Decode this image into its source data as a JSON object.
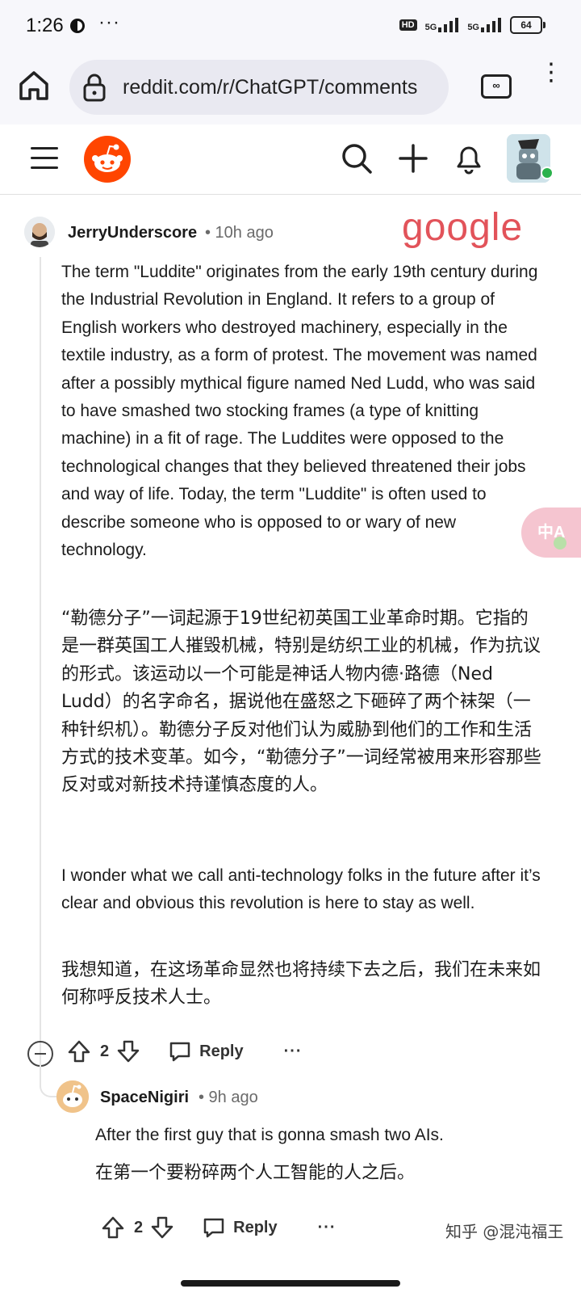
{
  "status_bar": {
    "time": "1:26",
    "more": "···",
    "hd": "HD",
    "signal1": "5G",
    "signal2": "5G",
    "battery": "64"
  },
  "browser": {
    "url": "reddit.com/r/ChatGPT/comments",
    "tabs_icon": "∞"
  },
  "comment": {
    "author": "JerryUnderscore",
    "time": "• 10h ago",
    "tag": "google",
    "body_en_1": "The term \"Luddite\" originates from the early 19th century during the Industrial Revolution in England. It refers to a group of English workers who destroyed machinery, especially in the textile industry, as a form of protest. The movement was named after a possibly mythical figure named Ned Ludd, who was said to have smashed two stocking frames (a type of knitting machine) in a fit of rage. The Luddites were opposed to the technological changes that they believed threatened their jobs and way of life. Today, the term \"Luddite\" is often used to describe someone who is opposed to or wary of new technology.",
    "body_zh_1": "“勒德分子”一词起源于19世纪初英国工业革命时期。它指的是一群英国工人摧毁机械，特别是纺织工业的机械，作为抗议的形式。该运动以一个可能是神话人物内德·路德（Ned Ludd）的名字命名，据说他在盛怒之下砸碎了两个袜架（一种针织机）。勒德分子反对他们认为威胁到他们的工作和生活方式的技术变革。如今，“勒德分子”一词经常被用来形容那些反对或对新技术持谨慎态度的人。",
    "body_en_2": "I wonder what we call anti-technology folks in the future after it’s clear and obvious this revolution is here to stay as well.",
    "body_zh_2": "我想知道，在这场革命显然也将持续下去之后，我们在未来如何称呼反技术人士。",
    "votes": "2",
    "reply_label": "Reply",
    "more_label": "···"
  },
  "reply": {
    "author": "SpaceNigiri",
    "time": "• 9h ago",
    "body_en": "After the first guy that is gonna smash two AIs.",
    "body_zh": "在第一个要粉碎两个人工智能的人之后。",
    "votes": "2",
    "reply_label": "Reply",
    "more_label": "···"
  },
  "overlay": {
    "translate_badge": "中A",
    "watermark": "知乎 @混沌福王"
  },
  "colors": {
    "reddit_orange": "#ff4500",
    "tag_red": "#e2535a",
    "online_green": "#2bb24c"
  }
}
